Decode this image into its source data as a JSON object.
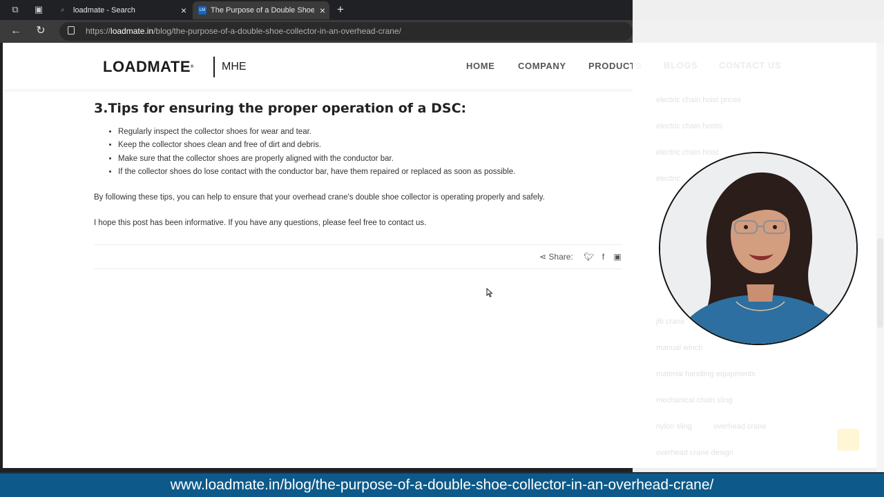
{
  "browser": {
    "tabs": [
      {
        "title": "loadmate - Search",
        "icon": "search-icon"
      },
      {
        "title": "The Purpose of a Double Shoe Co",
        "icon": "site-favicon"
      }
    ],
    "new_tab_label": "+",
    "url_prefix": "https://",
    "url_domain": "loadmate.in",
    "url_path": "/blog/the-purpose-of-a-double-shoe-collector-in-an-overhead-crane/"
  },
  "site": {
    "logo_main": "LOADMATE",
    "logo_reg": "®",
    "logo_sub": "MHE",
    "nav": [
      "HOME",
      "COMPANY",
      "PRODUCTS",
      "BLOGS",
      "CONTACT US"
    ]
  },
  "article": {
    "heading": "3.Tips for ensuring the proper operation of a DSC:",
    "tips": [
      "Regularly inspect the collector shoes for wear and tear.",
      "Keep the collector shoes clean and free of dirt and debris.",
      "Make sure that the collector shoes are properly aligned with the conductor bar.",
      "If the collector shoes do lose contact with the conductor bar, have them repaired or replaced as soon as possible."
    ],
    "paragraph_1": "By following these tips, you can help to ensure that your overhead crane's double shoe collector is operating properly and safely.",
    "paragraph_2": "I hope this post has been informative. If you have any questions, please feel free to contact us.",
    "share_label": "Share:"
  },
  "sidebar_tags": [
    "electric chain hoist prices",
    "electric chain hoists",
    "electric chain hoist",
    "electric",
    "jib crane",
    "manual winch",
    "material handling equipments",
    "mechanical chain sling",
    "nylon sling",
    "overhead crane",
    "overhead crane design"
  ],
  "caption": {
    "text": "www.loadmate.in/blog/the-purpose-of-a-double-shoe-collector-in-an-overhead-crane/"
  },
  "colors": {
    "caption_bg": "#0d5a8a",
    "browser_dark": "#202124",
    "heading": "#222222"
  }
}
